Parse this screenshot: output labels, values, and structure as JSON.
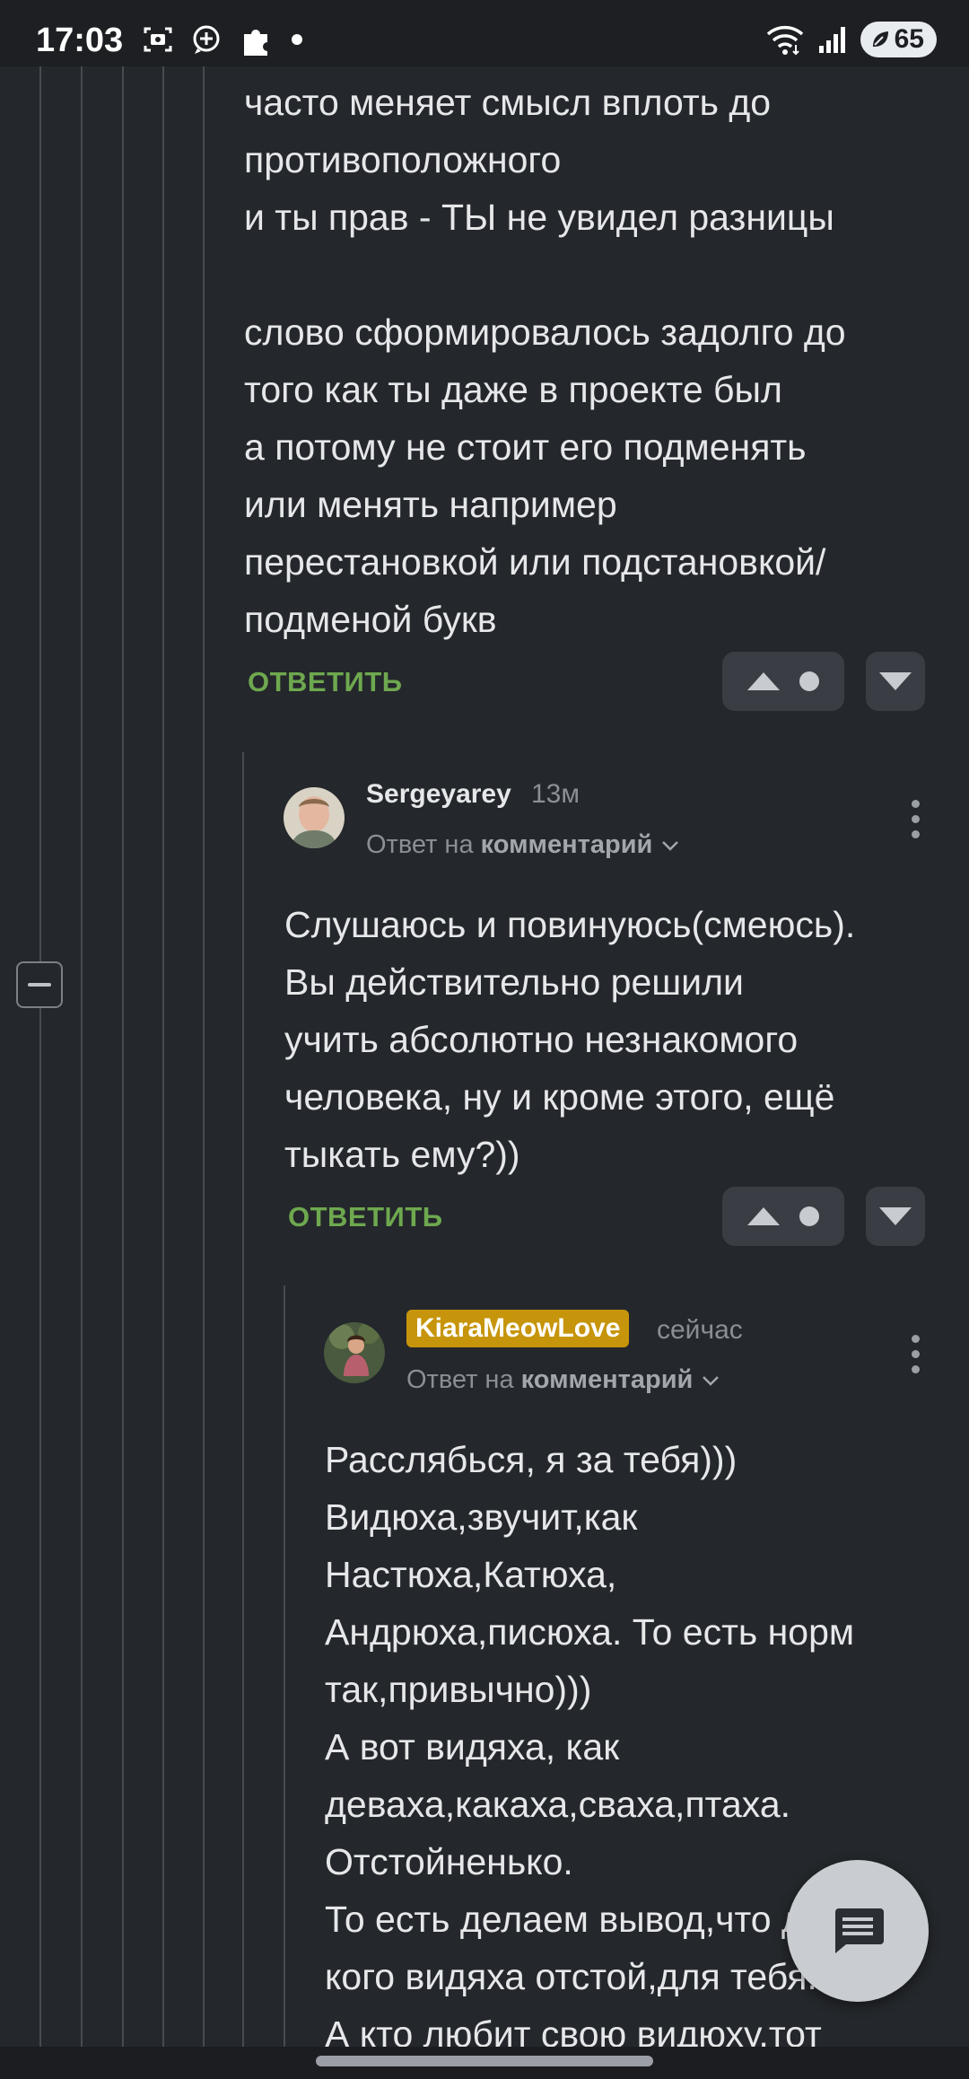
{
  "status_bar": {
    "time": "17:03",
    "left_icons": [
      "screenshot-icon",
      "add-circle-icon",
      "puzzle-icon",
      "dot-icon"
    ],
    "right_icons": [
      "wifi-icon",
      "signal-icon",
      "battery-leaf-icon"
    ],
    "battery": "65"
  },
  "thread": {
    "collapse_icon": "minus-icon"
  },
  "comments": [
    {
      "lines": [
        "часто меняет смысл вплоть до",
        "противоположного",
        "и ты прав - ТЫ не увидел разницы",
        "",
        "слово сформировалось задолго до",
        "того как ты даже в проекте был",
        "а потому не стоит его подменять",
        "или менять например",
        "перестановкой или подстановкой/",
        "подменой букв"
      ],
      "reply_label": "ОТВЕТИТЬ",
      "upvote_icon": "triangle-up-icon",
      "downvote_icon": "triangle-down-icon"
    },
    {
      "author": "Sergeyarey",
      "time": "13м",
      "reply_prefix": "Ответ на",
      "reply_target": "комментарий",
      "lines": [
        "Слушаюсь и повинуюсь(смеюсь).",
        "Вы действительно решили",
        "учить абсолютно незнакомого",
        "человека, ну и кроме этого, ещё",
        "тыкать ему?))"
      ],
      "reply_label": "ОТВЕТИТЬ"
    },
    {
      "author": "KiaraMeowLove",
      "time": "сейчас",
      "reply_prefix": "Ответ на",
      "reply_target": "комментарий",
      "lines": [
        "Расслябься, я за тебя)))",
        "Видюха,звучит,как",
        "Настюха,Катюха,",
        "Андрюха,писюха. То есть норм",
        "так,привычно)))",
        "А вот видяха, как",
        "деваха,какаха,сваха,птаха.",
        "Отстойненько.",
        "То есть делаем вывод,что для",
        "кого видяха отстой,для тебя.",
        "А кто любит свою видюху,тот"
      ]
    }
  ],
  "fab": {
    "icon": "message-icon"
  }
}
